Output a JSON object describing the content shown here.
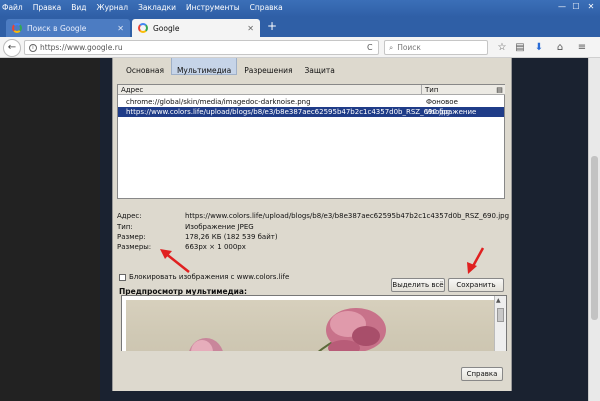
{
  "menu": [
    "Файл",
    "Правка",
    "Вид",
    "Журнал",
    "Закладки",
    "Инструменты",
    "Справка"
  ],
  "window_controls": {
    "minimize": "—",
    "maximize": "☐",
    "close": "✕"
  },
  "tabs": [
    {
      "label": "Поиск в Google",
      "close": "✕"
    },
    {
      "label": "Google",
      "close": "✕"
    }
  ],
  "new_tab": "+",
  "nav": {
    "back": "←",
    "url": "https://www.google.ru",
    "reload": "C",
    "search_placeholder": "Поиск",
    "icons": [
      "star-icon",
      "reading-list-icon",
      "download-icon",
      "home-icon",
      "menu-icon"
    ]
  },
  "dialog": {
    "tabs": [
      "Основная",
      "Мультимедиа",
      "Разрешения",
      "Защита"
    ],
    "active_tab": "Мультимедиа",
    "table": {
      "headers": {
        "address": "Адрес",
        "type": "Тип"
      },
      "rows": [
        {
          "address": "chrome://global/skin/media/imagedoc-darknoise.png",
          "type": "Фоновое изображение",
          "selected": false
        },
        {
          "address": "https://www.colors.life/upload/blogs/b8/e3/b8e387aec62595b47b2c1c4357d0b_RSZ_690.jpg",
          "type": "Изображение",
          "selected": true
        }
      ]
    },
    "props": {
      "address_label": "Адрес:",
      "address_value": "https://www.colors.life/upload/blogs/b8/e3/b8e387aec62595b47b2c1c4357d0b_RSZ_690.jpg",
      "type_label": "Тип:",
      "type_value": "Изображение JPEG",
      "size_label": "Размер:",
      "size_value": "178,26 КБ (182 539 байт)",
      "dims_label": "Размеры:",
      "dims_value": "663px × 1 000px"
    },
    "block_label": "Блокировать изображения с www.colors.life",
    "select_all": "Выделить всё",
    "save_as": "Сохранить как...",
    "preview_label": "Предпросмотр мультимедиа:",
    "help": "Справка"
  },
  "colors": {
    "arrow": "#e02020",
    "selection": "#1f3c88",
    "dialog_bg": "#ddd9ce"
  }
}
